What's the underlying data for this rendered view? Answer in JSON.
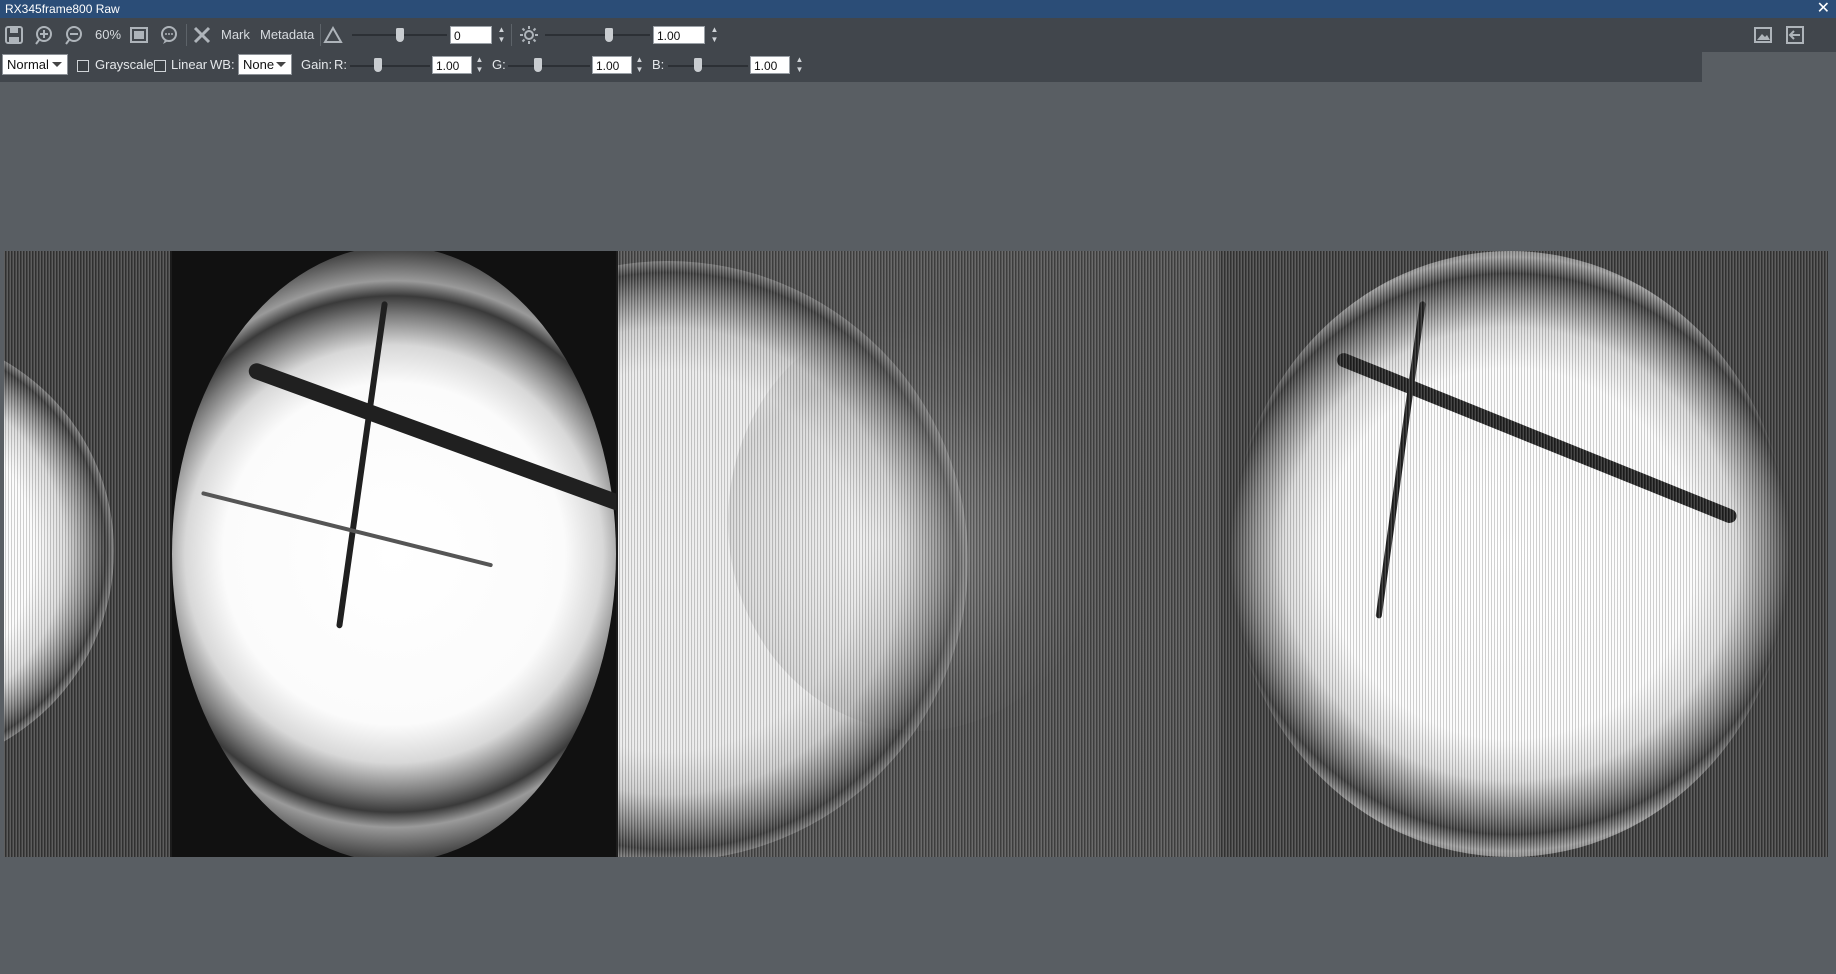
{
  "window": {
    "title": "RX345frame800 Raw",
    "close_glyph": "✕"
  },
  "toolbar": {
    "zoom_label": "60%",
    "mark_label": "Mark",
    "metadata_label": "Metadata",
    "contrast": {
      "value": "0",
      "slider_level": 0.5
    },
    "brightness": {
      "value": "1.00",
      "slider_level": 0.5
    },
    "right_icons": [
      "image-icon",
      "exit-icon"
    ]
  },
  "controls": {
    "mode_select": "Normal",
    "grayscale_label": "Grayscale",
    "grayscale_checked": false,
    "linear_label": "Linear",
    "linear_checked": false,
    "wb_label": "WB:",
    "wb_select": "None",
    "gain_label": "Gain:",
    "gains": [
      {
        "label": "R:",
        "value": "1.00",
        "slider_level": 0.3
      },
      {
        "label": "G:",
        "value": "1.00",
        "slider_level": 0.3
      },
      {
        "label": "B:",
        "value": "1.00",
        "slider_level": 0.3
      }
    ]
  },
  "image": {
    "name": "RX345frame800 Raw"
  }
}
